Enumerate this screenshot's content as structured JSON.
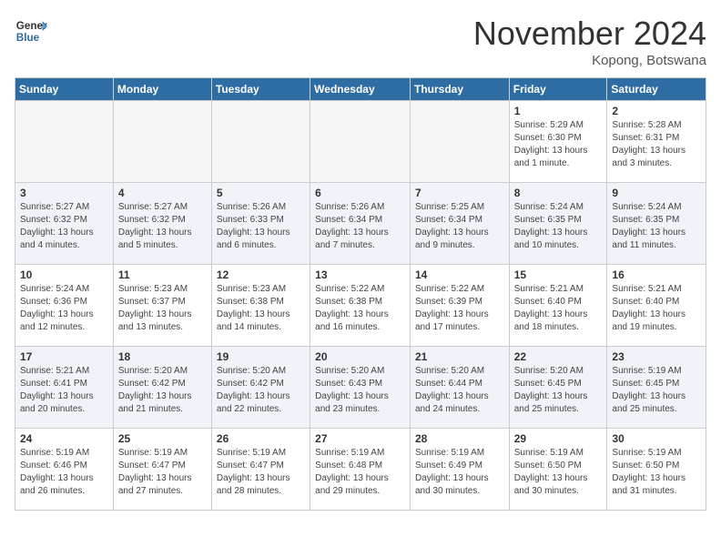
{
  "header": {
    "logo_general": "General",
    "logo_blue": "Blue",
    "month_title": "November 2024",
    "location": "Kopong, Botswana"
  },
  "days_of_week": [
    "Sunday",
    "Monday",
    "Tuesday",
    "Wednesday",
    "Thursday",
    "Friday",
    "Saturday"
  ],
  "weeks": [
    [
      {
        "day": "",
        "empty": true
      },
      {
        "day": "",
        "empty": true
      },
      {
        "day": "",
        "empty": true
      },
      {
        "day": "",
        "empty": true
      },
      {
        "day": "",
        "empty": true
      },
      {
        "day": "1",
        "sunrise": "Sunrise: 5:29 AM",
        "sunset": "Sunset: 6:30 PM",
        "daylight": "Daylight: 13 hours and 1 minute."
      },
      {
        "day": "2",
        "sunrise": "Sunrise: 5:28 AM",
        "sunset": "Sunset: 6:31 PM",
        "daylight": "Daylight: 13 hours and 3 minutes."
      }
    ],
    [
      {
        "day": "3",
        "sunrise": "Sunrise: 5:27 AM",
        "sunset": "Sunset: 6:32 PM",
        "daylight": "Daylight: 13 hours and 4 minutes."
      },
      {
        "day": "4",
        "sunrise": "Sunrise: 5:27 AM",
        "sunset": "Sunset: 6:32 PM",
        "daylight": "Daylight: 13 hours and 5 minutes."
      },
      {
        "day": "5",
        "sunrise": "Sunrise: 5:26 AM",
        "sunset": "Sunset: 6:33 PM",
        "daylight": "Daylight: 13 hours and 6 minutes."
      },
      {
        "day": "6",
        "sunrise": "Sunrise: 5:26 AM",
        "sunset": "Sunset: 6:34 PM",
        "daylight": "Daylight: 13 hours and 7 minutes."
      },
      {
        "day": "7",
        "sunrise": "Sunrise: 5:25 AM",
        "sunset": "Sunset: 6:34 PM",
        "daylight": "Daylight: 13 hours and 9 minutes."
      },
      {
        "day": "8",
        "sunrise": "Sunrise: 5:24 AM",
        "sunset": "Sunset: 6:35 PM",
        "daylight": "Daylight: 13 hours and 10 minutes."
      },
      {
        "day": "9",
        "sunrise": "Sunrise: 5:24 AM",
        "sunset": "Sunset: 6:35 PM",
        "daylight": "Daylight: 13 hours and 11 minutes."
      }
    ],
    [
      {
        "day": "10",
        "sunrise": "Sunrise: 5:24 AM",
        "sunset": "Sunset: 6:36 PM",
        "daylight": "Daylight: 13 hours and 12 minutes."
      },
      {
        "day": "11",
        "sunrise": "Sunrise: 5:23 AM",
        "sunset": "Sunset: 6:37 PM",
        "daylight": "Daylight: 13 hours and 13 minutes."
      },
      {
        "day": "12",
        "sunrise": "Sunrise: 5:23 AM",
        "sunset": "Sunset: 6:38 PM",
        "daylight": "Daylight: 13 hours and 14 minutes."
      },
      {
        "day": "13",
        "sunrise": "Sunrise: 5:22 AM",
        "sunset": "Sunset: 6:38 PM",
        "daylight": "Daylight: 13 hours and 16 minutes."
      },
      {
        "day": "14",
        "sunrise": "Sunrise: 5:22 AM",
        "sunset": "Sunset: 6:39 PM",
        "daylight": "Daylight: 13 hours and 17 minutes."
      },
      {
        "day": "15",
        "sunrise": "Sunrise: 5:21 AM",
        "sunset": "Sunset: 6:40 PM",
        "daylight": "Daylight: 13 hours and 18 minutes."
      },
      {
        "day": "16",
        "sunrise": "Sunrise: 5:21 AM",
        "sunset": "Sunset: 6:40 PM",
        "daylight": "Daylight: 13 hours and 19 minutes."
      }
    ],
    [
      {
        "day": "17",
        "sunrise": "Sunrise: 5:21 AM",
        "sunset": "Sunset: 6:41 PM",
        "daylight": "Daylight: 13 hours and 20 minutes."
      },
      {
        "day": "18",
        "sunrise": "Sunrise: 5:20 AM",
        "sunset": "Sunset: 6:42 PM",
        "daylight": "Daylight: 13 hours and 21 minutes."
      },
      {
        "day": "19",
        "sunrise": "Sunrise: 5:20 AM",
        "sunset": "Sunset: 6:42 PM",
        "daylight": "Daylight: 13 hours and 22 minutes."
      },
      {
        "day": "20",
        "sunrise": "Sunrise: 5:20 AM",
        "sunset": "Sunset: 6:43 PM",
        "daylight": "Daylight: 13 hours and 23 minutes."
      },
      {
        "day": "21",
        "sunrise": "Sunrise: 5:20 AM",
        "sunset": "Sunset: 6:44 PM",
        "daylight": "Daylight: 13 hours and 24 minutes."
      },
      {
        "day": "22",
        "sunrise": "Sunrise: 5:20 AM",
        "sunset": "Sunset: 6:45 PM",
        "daylight": "Daylight: 13 hours and 25 minutes."
      },
      {
        "day": "23",
        "sunrise": "Sunrise: 5:19 AM",
        "sunset": "Sunset: 6:45 PM",
        "daylight": "Daylight: 13 hours and 25 minutes."
      }
    ],
    [
      {
        "day": "24",
        "sunrise": "Sunrise: 5:19 AM",
        "sunset": "Sunset: 6:46 PM",
        "daylight": "Daylight: 13 hours and 26 minutes."
      },
      {
        "day": "25",
        "sunrise": "Sunrise: 5:19 AM",
        "sunset": "Sunset: 6:47 PM",
        "daylight": "Daylight: 13 hours and 27 minutes."
      },
      {
        "day": "26",
        "sunrise": "Sunrise: 5:19 AM",
        "sunset": "Sunset: 6:47 PM",
        "daylight": "Daylight: 13 hours and 28 minutes."
      },
      {
        "day": "27",
        "sunrise": "Sunrise: 5:19 AM",
        "sunset": "Sunset: 6:48 PM",
        "daylight": "Daylight: 13 hours and 29 minutes."
      },
      {
        "day": "28",
        "sunrise": "Sunrise: 5:19 AM",
        "sunset": "Sunset: 6:49 PM",
        "daylight": "Daylight: 13 hours and 30 minutes."
      },
      {
        "day": "29",
        "sunrise": "Sunrise: 5:19 AM",
        "sunset": "Sunset: 6:50 PM",
        "daylight": "Daylight: 13 hours and 30 minutes."
      },
      {
        "day": "30",
        "sunrise": "Sunrise: 5:19 AM",
        "sunset": "Sunset: 6:50 PM",
        "daylight": "Daylight: 13 hours and 31 minutes."
      }
    ]
  ]
}
